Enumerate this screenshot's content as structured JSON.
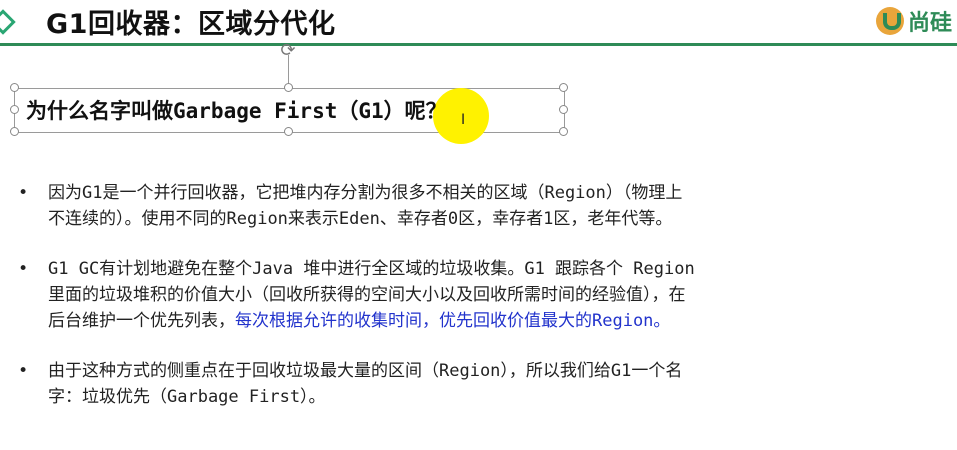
{
  "header": {
    "title": "G1回收器：区域分代化",
    "logo_text": "尚硅"
  },
  "selected_box": {
    "text": "为什么名字叫做Garbage First（G1）呢？"
  },
  "bullets": [
    {
      "lines": [
        "因为G1是一个并行回收器，它把堆内存分割为很多不相关的区域（Region）（物理上",
        "不连续的）。使用不同的Region来表示Eden、幸存者0区，幸存者1区，老年代等。"
      ]
    },
    {
      "lines": [
        "G1 GC有计划地避免在整个Java 堆中进行全区域的垃圾收集。G1 跟踪各个 Region",
        "里面的垃圾堆积的价值大小（回收所获得的空间大小以及回收所需时间的经验值），在"
      ],
      "tail_prefix": "后台维护一个优先列表，",
      "tail_blue": "每次根据允许的收集时间，优先回收价值最大的Region。"
    },
    {
      "lines": [
        "由于这种方式的侧重点在于回收垃圾最大量的区间（Region），所以我们给G1一个名",
        "字：垃圾优先（Garbage First）。"
      ]
    }
  ],
  "colors": {
    "accent_green": "#2e8b57",
    "highlight_yellow": "#fff200",
    "emphasis_blue": "#2233cc"
  }
}
